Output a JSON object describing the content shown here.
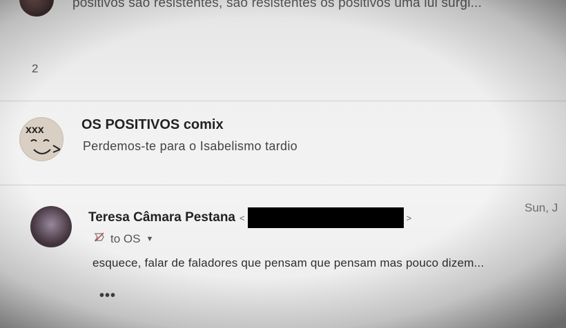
{
  "top_thread": {
    "snippet": "positivos são resistentes, são resistentes os positivos uma lui surgi..."
  },
  "thread_count": "2",
  "comix_message": {
    "sender": "OS POSITIVOS comix",
    "subject": "Perdemos-te para o Isabelismo tardio",
    "avatar_icon": "comic-face-avatar"
  },
  "teresa_message": {
    "sender": "Teresa Câmara Pestana",
    "email_open": "<",
    "email_close": ">",
    "date": "Sun, J",
    "to_label": "to OS",
    "body": "esquece, falar de faladores que pensam que pensam mas pouco dizem...",
    "more": "•••"
  },
  "colors": {
    "redaction": "#000000",
    "text": "#2b2b2b",
    "muted": "#555555"
  }
}
